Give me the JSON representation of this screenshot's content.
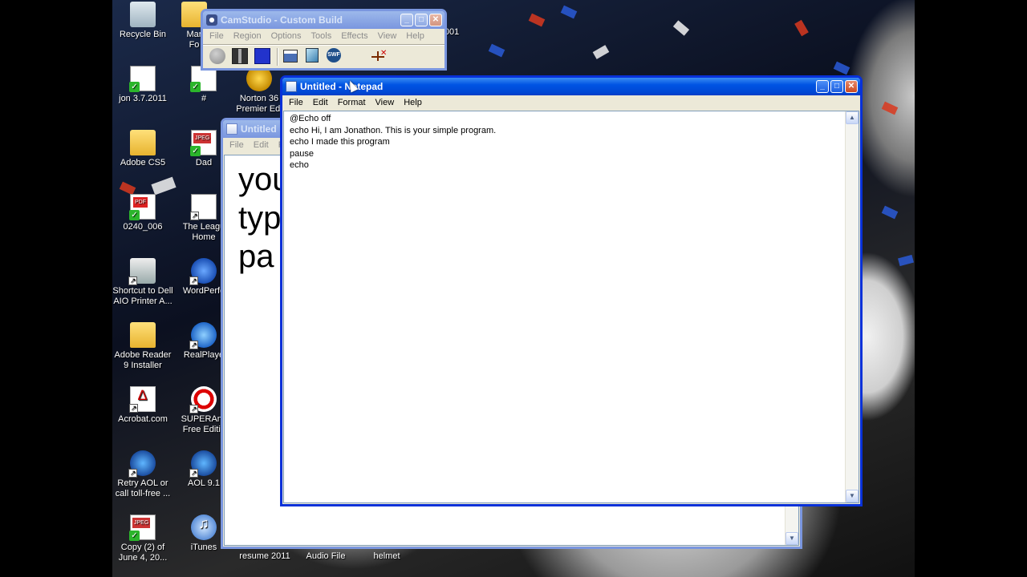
{
  "desktop": {
    "icons": [
      {
        "label": "Recycle Bin",
        "type": "bin"
      },
      {
        "label": "Mar\nFo",
        "type": "folder"
      },
      {
        "label": "jon 3.7.2011",
        "type": "doc"
      },
      {
        "label": "#",
        "type": "doc"
      },
      {
        "label": "Norton 36\nPremier Edi",
        "type": "norton"
      },
      {
        "label": "Adobe CS5",
        "type": "folder"
      },
      {
        "label": "Dad",
        "type": "jpeg"
      },
      {
        "label": "0240_006",
        "type": "pdf"
      },
      {
        "label": "The Leagu\nHome",
        "type": "doc"
      },
      {
        "label": "Shortcut to Dell\nAIO Printer A...",
        "type": "printer"
      },
      {
        "label": "WordPerfe",
        "type": "wp"
      },
      {
        "label": "Adobe Reader\n9 Installer",
        "type": "folder"
      },
      {
        "label": "RealPlaye",
        "type": "real"
      },
      {
        "label": "Acrobat.com",
        "type": "acro"
      },
      {
        "label": "SUPERAnti\nFree Editic",
        "type": "super"
      },
      {
        "label": "Retry AOL or\ncall toll-free ...",
        "type": "aol"
      },
      {
        "label": "AOL 9.1",
        "type": "aol"
      },
      {
        "label": "Copy (2) of\nJune 4, 20...",
        "type": "jpeg"
      },
      {
        "label": "iTunes",
        "type": "itunes"
      },
      {
        "label": "resume 2011",
        "type": "doc"
      },
      {
        "label": "Audio File",
        "type": "doc"
      },
      {
        "label": "helmet",
        "type": "doc"
      },
      {
        "label": "_001",
        "type": "pdf"
      }
    ]
  },
  "camstudio": {
    "title": "CamStudio - Custom Build",
    "menu": [
      "File",
      "Region",
      "Options",
      "Tools",
      "Effects",
      "View",
      "Help"
    ],
    "toolbar": [
      "record-icon",
      "pause-icon",
      "stop-icon",
      "region-icon",
      "annotation-icon",
      "swf-icon",
      "settings-icon"
    ]
  },
  "notepad_back": {
    "title": "Untitled",
    "menu": [
      "File",
      "Edit",
      "Fo"
    ],
    "lines": [
      "you",
      "typ",
      "pa"
    ]
  },
  "notepad": {
    "title": "Untitled - Notepad",
    "menu": [
      "File",
      "Edit",
      "Format",
      "View",
      "Help"
    ],
    "lines": [
      "@Echo off",
      "echo Hi, I am Jonathon. This is your simple program.",
      "echo I made this program",
      "pause",
      "echo"
    ]
  },
  "colors": {
    "xp_title": "#0054e3",
    "xp_border": "#0831d9",
    "xp_face": "#ece9d8"
  }
}
